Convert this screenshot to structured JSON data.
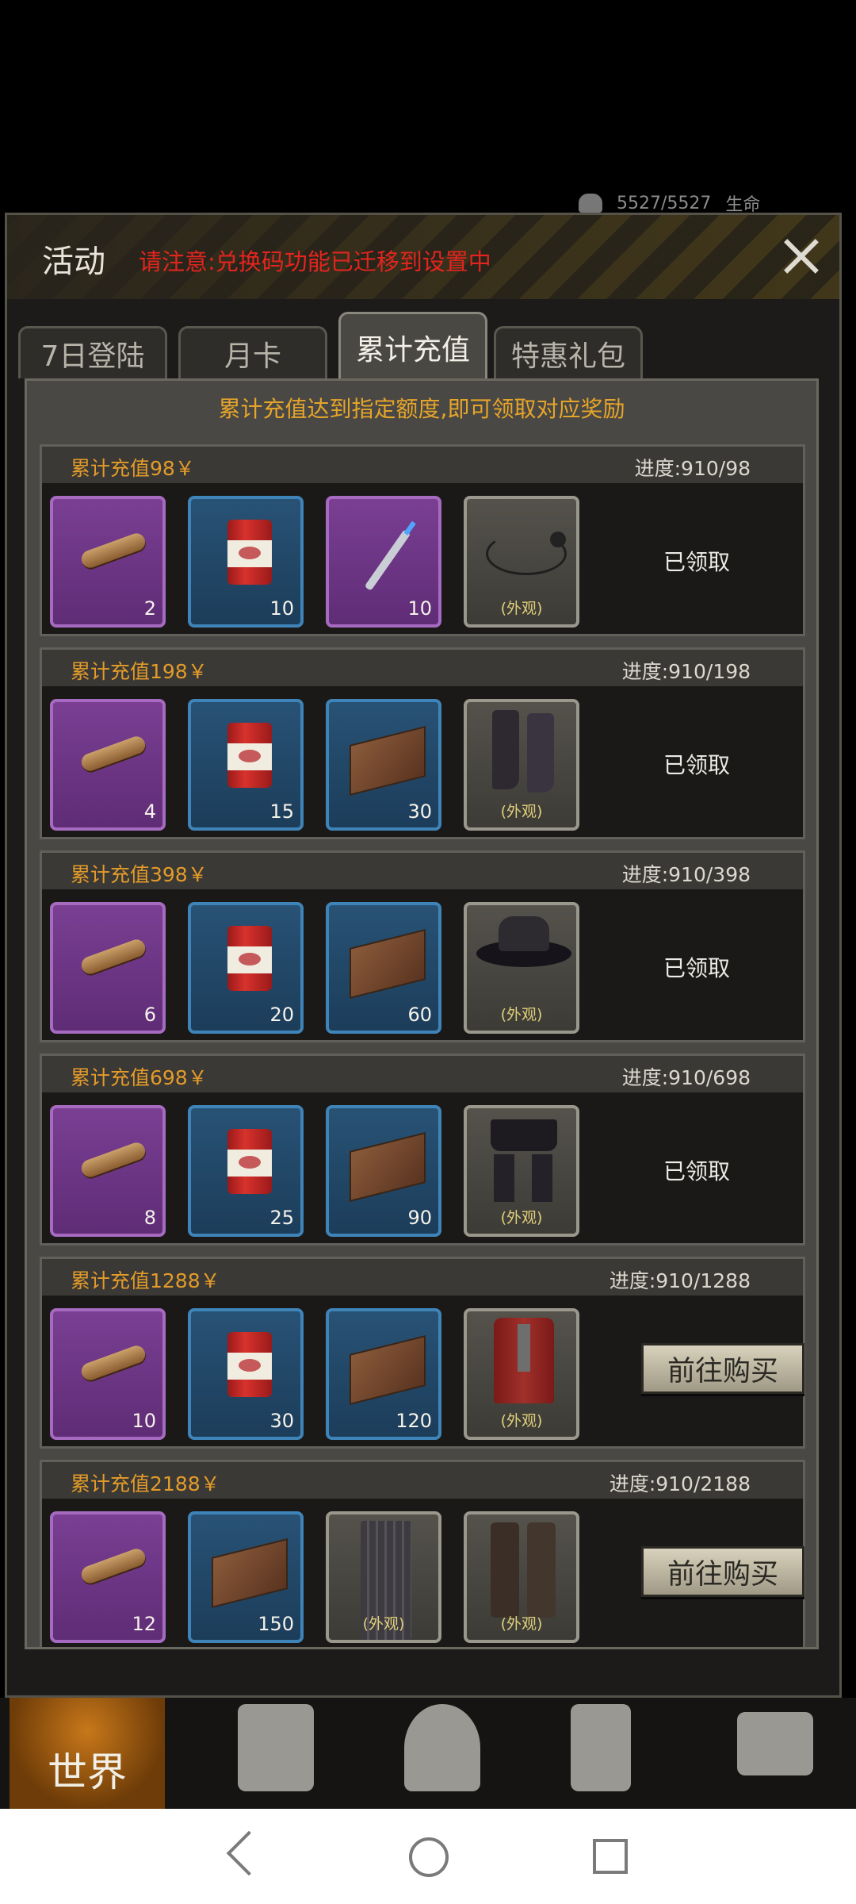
{
  "hud": {
    "stamina": "5527/5527",
    "life_label": "生命"
  },
  "window": {
    "title": "活动",
    "notice": "请注意:兑换码功能已迁移到设置中"
  },
  "tabs": [
    {
      "label": "7日登陆"
    },
    {
      "label": "月卡"
    },
    {
      "label": "累计充值",
      "active": true
    },
    {
      "label": "特惠礼包"
    }
  ],
  "banner": "累计充值达到指定额度,即可领取对应奖励",
  "appearance_label": "(外观)",
  "claimed_label": "已领取",
  "buy_label": "前往购买",
  "groups": [
    {
      "name": "累计充值98￥",
      "progress": "进度:910/98",
      "status": "claimed",
      "items": [
        {
          "icon": "cigar-icon",
          "count": "2"
        },
        {
          "icon": "meat-can-icon",
          "count": "10"
        },
        {
          "icon": "syringe-icon",
          "count": "10"
        },
        {
          "icon": "necklace-icon",
          "appearance": true
        }
      ]
    },
    {
      "name": "累计充值198￥",
      "progress": "进度:910/198",
      "status": "claimed",
      "items": [
        {
          "icon": "cigar-icon",
          "count": "4"
        },
        {
          "icon": "meat-can-icon",
          "count": "15"
        },
        {
          "icon": "ammo-box-icon",
          "count": "30"
        },
        {
          "icon": "boots-icon",
          "appearance": true
        }
      ]
    },
    {
      "name": "累计充值398￥",
      "progress": "进度:910/398",
      "status": "claimed",
      "items": [
        {
          "icon": "cigar-icon",
          "count": "6"
        },
        {
          "icon": "meat-can-icon",
          "count": "20"
        },
        {
          "icon": "ammo-box-icon",
          "count": "60"
        },
        {
          "icon": "hat-icon",
          "appearance": true
        }
      ]
    },
    {
      "name": "累计充值698￥",
      "progress": "进度:910/698",
      "status": "claimed",
      "items": [
        {
          "icon": "cigar-icon",
          "count": "8"
        },
        {
          "icon": "meat-can-icon",
          "count": "25"
        },
        {
          "icon": "ammo-box-icon",
          "count": "90"
        },
        {
          "icon": "shorts-icon",
          "appearance": true
        }
      ]
    },
    {
      "name": "累计充值1288￥",
      "progress": "进度:910/1288",
      "status": "buy",
      "items": [
        {
          "icon": "cigar-icon",
          "count": "10"
        },
        {
          "icon": "meat-can-icon",
          "count": "30"
        },
        {
          "icon": "ammo-box-icon",
          "count": "120"
        },
        {
          "icon": "coat-icon",
          "appearance": true
        }
      ]
    },
    {
      "name": "累计充值2188￥",
      "progress": "进度:910/2188",
      "status": "buy",
      "items": [
        {
          "icon": "cigar-icon",
          "count": "12"
        },
        {
          "icon": "ammo-box-icon",
          "count": "150"
        },
        {
          "icon": "pants-icon",
          "appearance": true
        },
        {
          "icon": "tall-boots-icon",
          "appearance": true
        }
      ]
    }
  ],
  "bottom_nav": {
    "world_label": "世界"
  },
  "colors": {
    "accent_orange": "#e39b2a",
    "notice_red": "#e2251e",
    "rare_purple": "#7a3f93",
    "rare_blue": "#285275"
  }
}
